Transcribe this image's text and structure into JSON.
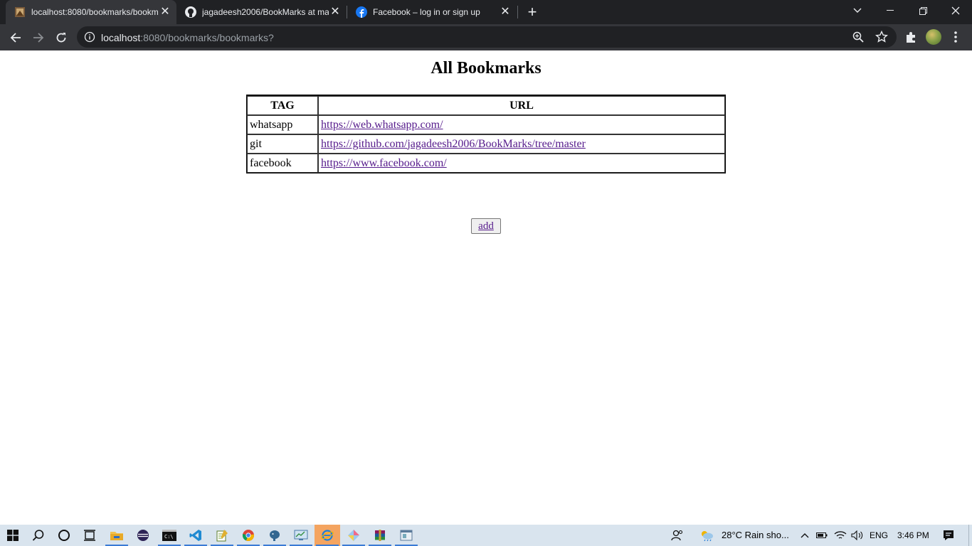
{
  "browser": {
    "tabs": [
      {
        "title": "localhost:8080/bookmarks/bookm",
        "favicon": "bookmark-site-icon"
      },
      {
        "title": "jagadeesh2006/BookMarks at ma",
        "favicon": "github-icon"
      },
      {
        "title": "Facebook – log in or sign up",
        "favicon": "facebook-icon"
      }
    ],
    "address": {
      "host": "localhost",
      "rest": ":8080/bookmarks/bookmarks?"
    }
  },
  "page": {
    "heading": "All Bookmarks",
    "table": {
      "headers": [
        "TAG",
        "URL"
      ],
      "rows": [
        {
          "tag": "whatsapp",
          "url": "https://web.whatsapp.com/"
        },
        {
          "tag": "git",
          "url": "https://github.com/jagadeesh2006/BookMarks/tree/master"
        },
        {
          "tag": "facebook",
          "url": "https://www.facebook.com/"
        }
      ]
    },
    "add_label": "add"
  },
  "taskbar": {
    "weather": "28°C  Rain sho...",
    "language": "ENG",
    "time": "3:46 PM"
  },
  "colors": {
    "chrome_dark": "#202124",
    "chrome_toolbar": "#35363a",
    "link_visited": "#551a8b",
    "taskbar": "#d9e4ee"
  }
}
